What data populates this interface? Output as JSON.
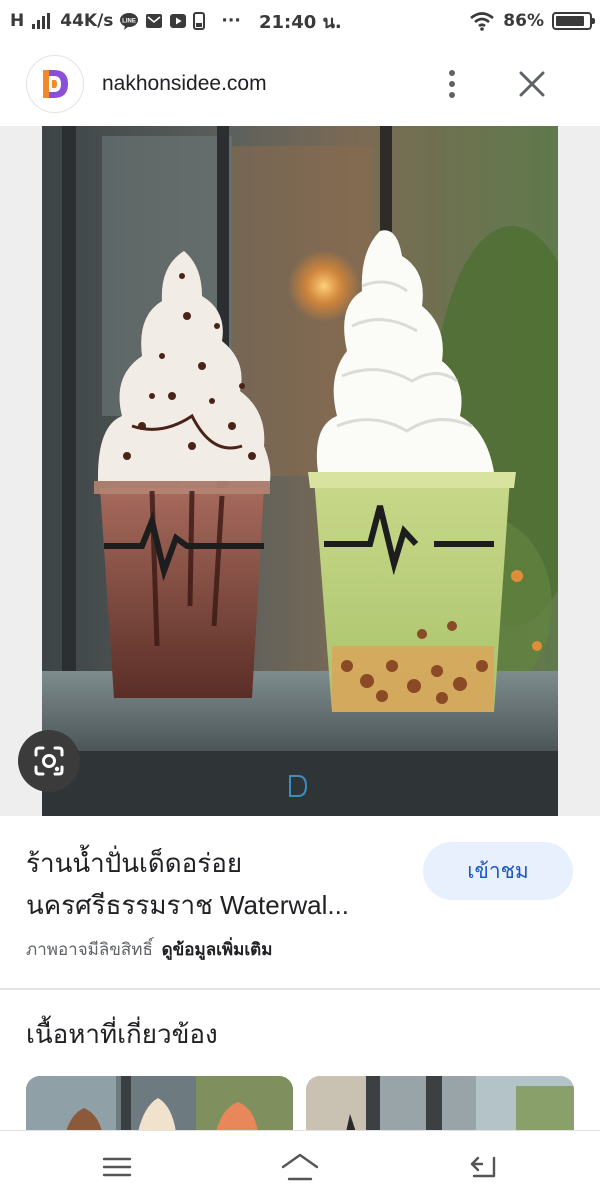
{
  "status_bar": {
    "network": "H",
    "speed": "44K/s",
    "notification_icons": [
      "line-icon",
      "mail-icon",
      "youtube-icon",
      "phone-icon"
    ],
    "more": "···",
    "time": "21:40 น.",
    "battery_percent": "86%",
    "battery_level": 0.86
  },
  "header": {
    "domain": "nakhonsidee.com",
    "logo_icon": "site-logo-icon",
    "more_icon": "more-vert-icon",
    "close_icon": "close-icon"
  },
  "image": {
    "lens_icon": "google-lens-icon"
  },
  "result": {
    "title": "ร้านน้ำปั่นเด็ดอร่อย นครศรีธรรมราช Waterwal...",
    "visit_label": "เข้าชม",
    "copyright_notice": "ภาพอาจมีลิขสิทธิ์",
    "more_info_label": "ดูข้อมูลเพิ่มเติม"
  },
  "related": {
    "heading": "เนื้อหาที่เกี่ยวข้อง"
  },
  "nav_bar": {
    "menu_icon": "menu-icon",
    "home_icon": "home-icon",
    "back_icon": "back-icon"
  },
  "colors": {
    "accent": "#1a56c4",
    "button_bg": "#e8f0fe",
    "logo_purple": "#8b4fd8",
    "logo_orange": "#f28a2b"
  }
}
